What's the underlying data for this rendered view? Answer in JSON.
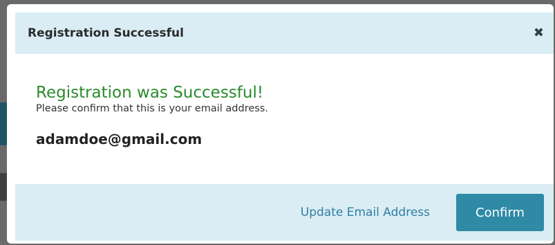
{
  "modal": {
    "title": "Registration Successful",
    "close_icon": "close-icon",
    "heading": "Registration was Successful!",
    "message": "Please confirm that this is your email address.",
    "email": "adamdoe@gmail.com"
  },
  "footer": {
    "update_label": "Update Email Address",
    "confirm_label": "Confirm"
  },
  "colors": {
    "header_bg": "#daedf5",
    "success_green": "#2b8a2b",
    "primary_button": "#2f8aa6",
    "link": "#2f7fa2"
  }
}
